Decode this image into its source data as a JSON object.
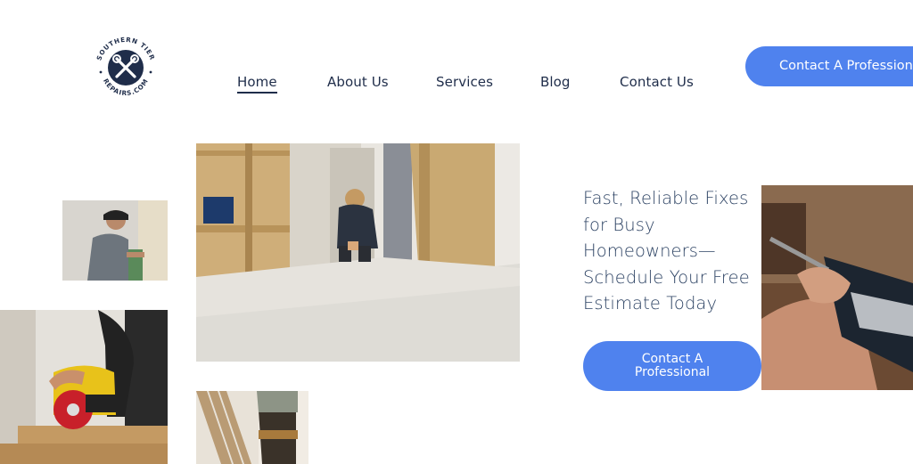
{
  "brand": {
    "logo_text_top": "SOUTHERN TIER",
    "logo_text_bottom": "REPAIRS.COM",
    "logo_color": "#1f2d4a"
  },
  "nav": {
    "items": [
      {
        "label": "Home",
        "active": true
      },
      {
        "label": "About Us",
        "active": false
      },
      {
        "label": "Services",
        "active": false
      },
      {
        "label": "Blog",
        "active": false
      },
      {
        "label": "Contact Us",
        "active": false
      }
    ]
  },
  "header_cta": {
    "label": "Contact A Profession"
  },
  "hero": {
    "headline": "Fast, Reliable Fixes for Busy Homeowners—Schedule Your Free Estimate Today",
    "cta_label": "Contact A Professional"
  },
  "colors": {
    "accent": "#4f82ee",
    "text": "#1f2d4a",
    "headline": "#2c4263"
  },
  "icons": {
    "logo": "wrench-screwdriver-cross-icon"
  }
}
